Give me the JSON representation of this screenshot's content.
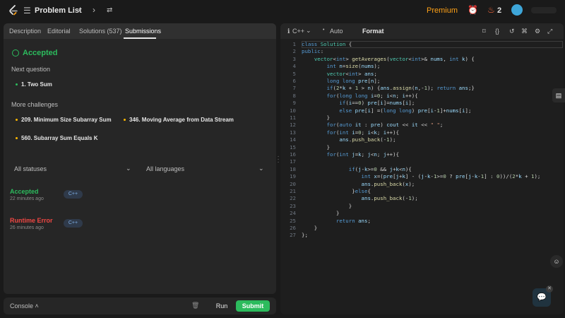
{
  "topbar": {
    "title": "Problem List",
    "premium": "Premium",
    "streak": "2"
  },
  "tabs": [
    "Description",
    "Editorial",
    "Solutions (537)",
    "Submissions"
  ],
  "result": {
    "status": "Accepted",
    "next_title": "Next question",
    "next_items": [
      "1. Two Sum"
    ],
    "more_title": "More challenges",
    "more_items": [
      "209. Minimum Size Subarray Sum",
      "346. Moving Average from Data Stream",
      "560. Subarray Sum Equals K"
    ]
  },
  "filters": {
    "status": "All statuses",
    "language": "All languages"
  },
  "submissions": [
    {
      "status": "Accepted",
      "time": "22 minutes ago",
      "lang": "C++"
    },
    {
      "status": "Runtime Error",
      "time": "26 minutes ago",
      "lang": "C++"
    }
  ],
  "console": {
    "label": "Console",
    "run": "Run",
    "submit": "Submit"
  },
  "editor": {
    "language": "C++",
    "mode": "Auto",
    "format": "Format"
  },
  "code_lines": [
    "class Solution {",
    "public:",
    "    vector<int> getAverages(vector<int>& nums, int k) {",
    "        int n=size(nums);",
    "        vector<int> ans;",
    "        long long pre[n];",
    "        if(2*k + 1 > n) {ans.assign(n,-1); return ans;}",
    "        for(long long i=0; i<n; i++){",
    "            if(i==0) pre[i]=nums[i];",
    "            else pre[i] =(long long) pre[i-1]+nums[i];",
    "        }",
    "        for(auto it : pre) cout << it << \" \";",
    "        for(int i=0; i<k; i++){",
    "            ans.push_back(-1);",
    "        }",
    "        for(int j=k; j<n; j++){",
    "",
    "               if(j-k>=0 && j+k<n){",
    "                   int x=(pre[j+k] - (j-k-1>=0 ? pre[j-k-1] : 0))/(2*k + 1);",
    "                   ans.push_back(x);",
    "                }else{",
    "                   ans.push_back(-1);",
    "               }",
    "           }",
    "           return ans;",
    "    }",
    "};"
  ],
  "colors": {
    "accent_green": "#2cbb5d",
    "error_red": "#ef4743",
    "premium_orange": "#ffa116"
  }
}
